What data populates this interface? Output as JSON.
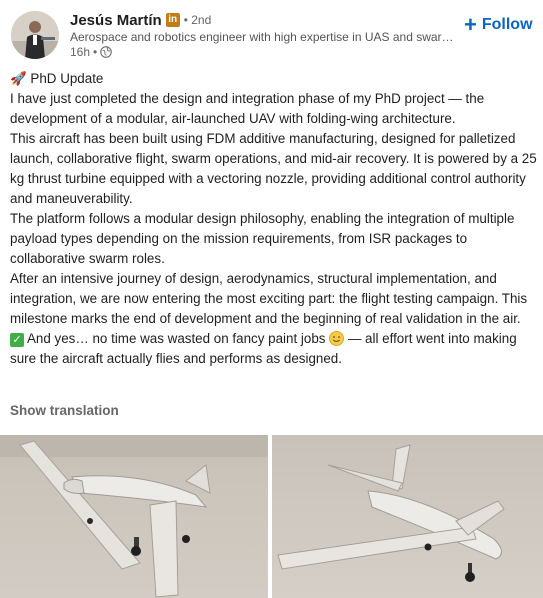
{
  "author": {
    "name": "Jesús Martín",
    "badge": "in",
    "degree": "• 2nd",
    "headline": "Aerospace and robotics engineer with high expertise in UAS and swarmi…",
    "time": "16h",
    "time_sep": "•",
    "visibility_icon": "globe-icon",
    "avatar_icon": "profile-photo"
  },
  "follow": {
    "plus": "+",
    "label": "Follow"
  },
  "post": {
    "title_emoji": "🚀",
    "title": "PhD Update",
    "p1": "I have just completed the design and integration phase of my PhD project — the development of a modular, air-launched UAV with folding-wing architecture.",
    "p2": "This aircraft has been built using FDM additive manufacturing, designed for palletized launch, collaborative flight, swarm operations, and mid-air recovery. It is powered by a 25 kg thrust turbine equipped with a vectoring nozzle, providing additional control authority and maneuverability.",
    "p3": "The platform follows a modular design philosophy, enabling the integration of multiple payload types depending on the mission requirements, from ISR packages to collaborative swarm roles.",
    "p4": "After an intensive journey of design, aerodynamics, structural implementation, and integration, we are now entering the most exciting part: the flight testing campaign. This milestone marks the end of development and the beginning of real validation in the air.",
    "p5a": "And yes… no time was wasted on fancy paint jobs",
    "p5b": "— all effort went into making sure the aircraft actually flies and performs as designed."
  },
  "show_translation": "Show translation",
  "colors": {
    "accent": "#0a66c2",
    "badge": "#c37d16",
    "check": "#3fae49"
  }
}
